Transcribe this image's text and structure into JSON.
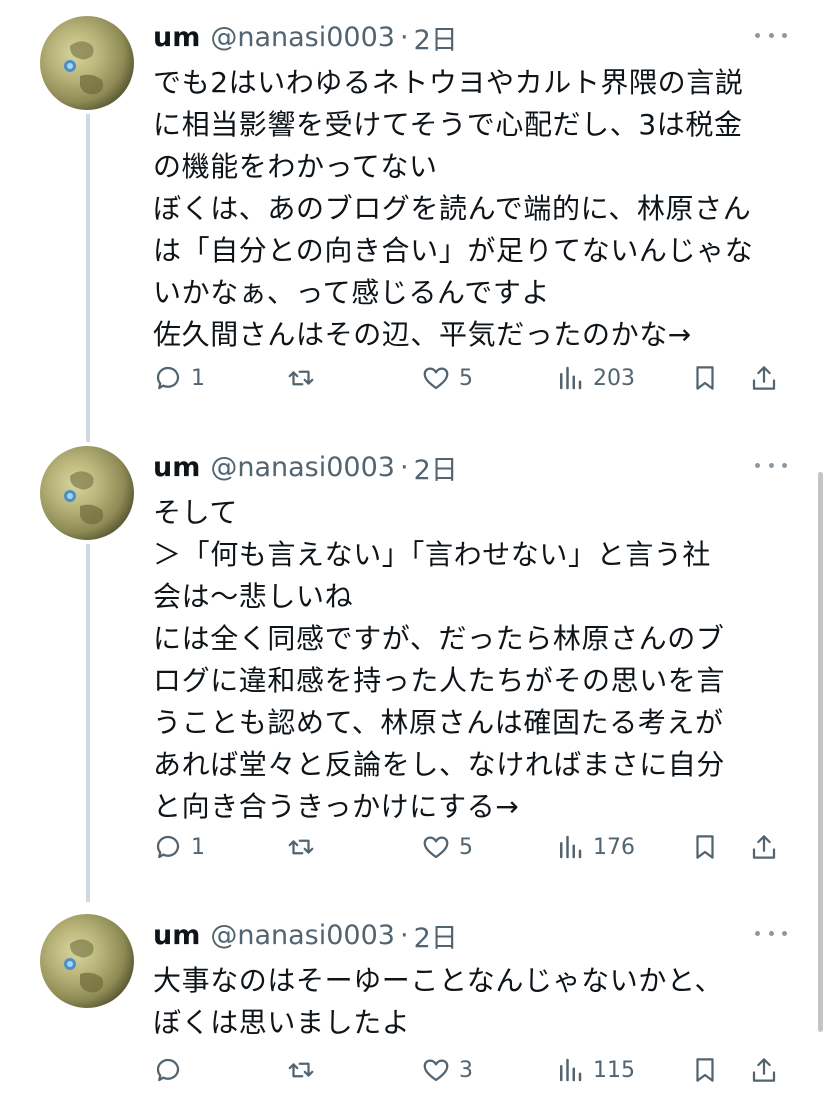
{
  "tweets": [
    {
      "name": "um",
      "handle": "@nanasi0003",
      "dot": "·",
      "time": "2日",
      "lines": [
        "でも2はいわゆるネトウヨやカルト界隈の言説",
        "に相当影響を受けてそうで心配だし、3は税金",
        "の機能をわかってない",
        "ぼくは、あのブログを読んで端的に、林原さん",
        "は「自分との向き合い」が足りてないんじゃな",
        "いかなぁ、って感じるんですよ",
        "佐久間さんはその辺、平気だったのかな→"
      ],
      "replies": "1",
      "retweets": "",
      "likes": "5",
      "views": "203"
    },
    {
      "name": "um",
      "handle": "@nanasi0003",
      "dot": "·",
      "time": "2日",
      "lines": [
        "そして",
        "＞「何も言えない」「言わせない」と言う社",
        "会は〜悲しいね",
        "には全く同感ですが、だったら林原さんのブ",
        "ログに違和感を持った人たちがその思いを言",
        "うことも認めて、林原さんは確固たる考えが",
        "あれば堂々と反論をし、なければまさに自分",
        "と向き合うきっかけにする→"
      ],
      "replies": "1",
      "retweets": "",
      "likes": "5",
      "views": "176"
    },
    {
      "name": "um",
      "handle": "@nanasi0003",
      "dot": "·",
      "time": "2日",
      "lines": [
        "大事なのはそーゆーことなんじゃないかと、",
        "ぼくは思いましたよ"
      ],
      "replies": "",
      "retweets": "",
      "likes": "3",
      "views": "115"
    }
  ],
  "icons": {
    "reply": "reply-bubble-icon",
    "retweet": "retweet-arrows-icon",
    "like": "heart-icon",
    "views": "views-bar-chart-icon",
    "bookmark": "bookmark-icon",
    "share": "share-upload-icon",
    "more": "more-dots-icon"
  },
  "colors": {
    "text": "#0f1419",
    "secondary": "#536471",
    "thread_line": "#cfd9de",
    "background": "#ffffff"
  }
}
